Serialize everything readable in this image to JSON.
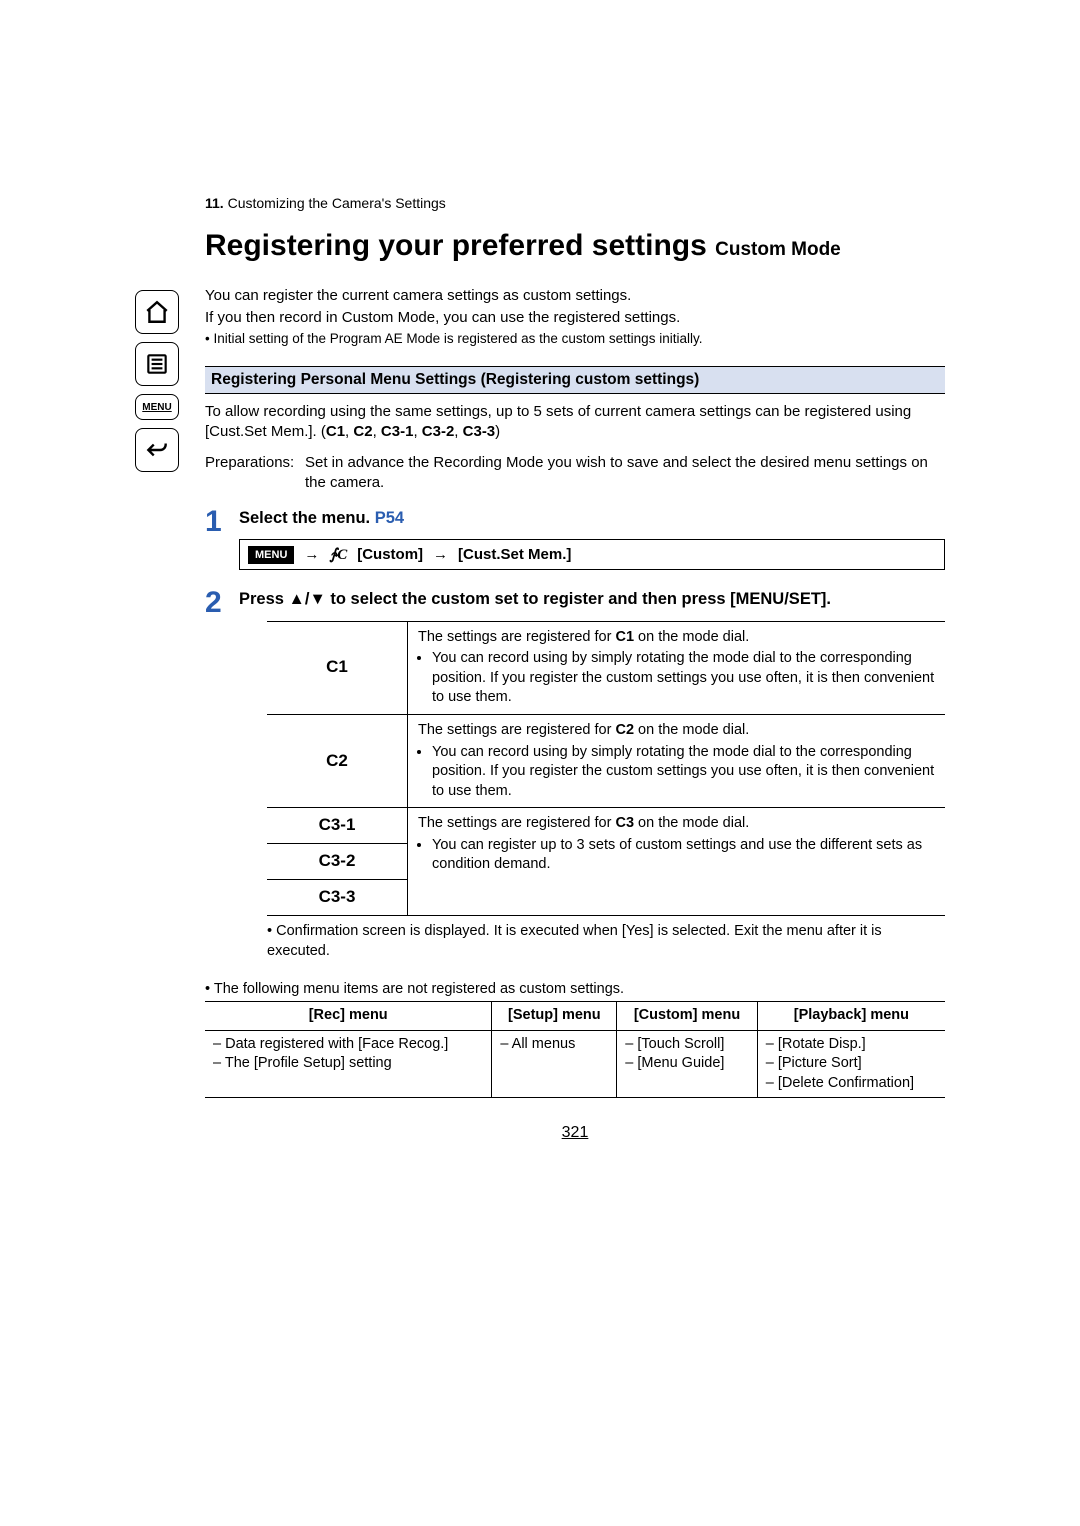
{
  "chapter": {
    "num": "11.",
    "title": "Customizing the Camera's Settings"
  },
  "heading": {
    "main": "Registering your preferred settings",
    "sub": "Custom Mode"
  },
  "intro": {
    "l1": "You can register the current camera settings as custom settings.",
    "l2": "If you then record in Custom Mode, you can use the registered settings.",
    "note": "• Initial setting of the Program AE Mode is registered as the custom settings initially."
  },
  "section_bar": "Registering Personal Menu Settings (Registering custom settings)",
  "allow_para_a": "To allow recording using the same settings, up to 5 sets of current camera settings can be registered using [Cust.Set Mem.]. (",
  "allow_para_b": ")",
  "c_labels": {
    "c1": "C1",
    "c2": "C2",
    "c31": "C3-1",
    "c32": "C3-2",
    "c33": "C3-3"
  },
  "prep": {
    "label": "Preparations:",
    "text": "Set in advance the Recording Mode you wish to save and select the desired menu settings on the camera."
  },
  "step1": {
    "num": "1",
    "title": "Select the menu.",
    "ref": "P54",
    "menu_chip": "MENU",
    "fc": "∱C",
    "path1": "[Custom]",
    "path2": "[Cust.Set Mem.]"
  },
  "step2": {
    "num": "2",
    "title_a": "Press ",
    "title_b": " to select the custom set to register and then press [MENU/SET].",
    "arrows": "▲/▼"
  },
  "ctable": {
    "rows": [
      {
        "key": "C1",
        "main_a": "The settings are registered for ",
        "dial": "C1",
        "main_b": " on the mode dial.",
        "bullet": "You can record using by simply rotating the mode dial to the corresponding position. If you register the custom settings you use often, it is then convenient to use them."
      },
      {
        "key": "C2",
        "main_a": "The settings are registered for ",
        "dial": "C2",
        "main_b": " on the mode dial.",
        "bullet": "You can record using by simply rotating the mode dial to the corresponding position. If you register the custom settings you use often, it is then convenient to use them."
      }
    ],
    "c3": {
      "keys": [
        "C3-1",
        "C3-2",
        "C3-3"
      ],
      "main_a": "The settings are registered for ",
      "dial": "C3",
      "main_b": " on the mode dial.",
      "bullet": "You can register up to 3 sets of custom settings and use the different sets as condition demand."
    }
  },
  "confirm_note": "Confirmation screen is displayed. It is executed when [Yes] is selected. Exit the menu after it is executed.",
  "follow_note": "The following menu items are not registered as custom settings.",
  "menu_table": {
    "headers": [
      "[Rec] menu",
      "[Setup] menu",
      "[Custom] menu",
      "[Playback] menu"
    ],
    "cols": [
      [
        "– Data registered with [Face Recog.]",
        "– The [Profile Setup] setting"
      ],
      [
        "– All menus"
      ],
      [
        "– [Touch Scroll]",
        "– [Menu Guide]"
      ],
      [
        "– [Rotate Disp.]",
        "– [Picture Sort]",
        "– [Delete Confirmation]"
      ]
    ]
  },
  "page_number": "321",
  "sidebar": {
    "menu_label": "MENU"
  }
}
